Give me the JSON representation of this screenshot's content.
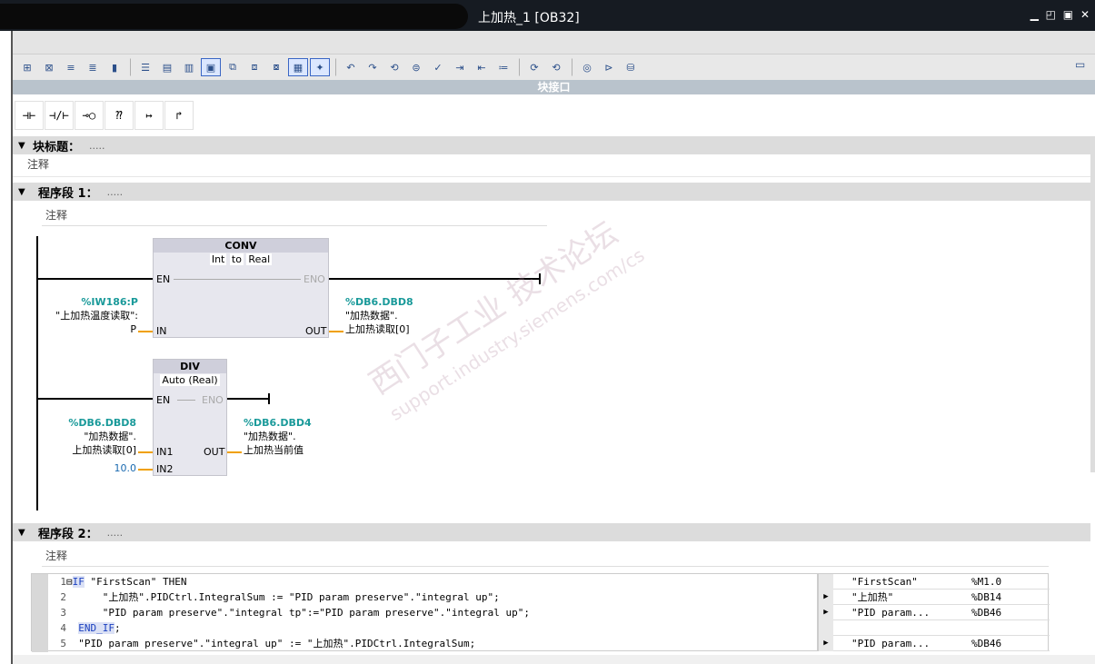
{
  "window": {
    "title": "上加热_1 [OB32]",
    "controls": "▁ ◰ ▣ ✕"
  },
  "interface_bar": {
    "label": "块接口"
  },
  "ladder_toolbar": {
    "items": [
      "⊣⊢",
      "⊣/⊢",
      "⊸○",
      "⁇",
      "↦",
      "↱"
    ]
  },
  "block_title": {
    "label": "块标题：",
    "dots": ".....",
    "comment": "注释"
  },
  "network1": {
    "label": "程序段 1：",
    "dots": ".....",
    "comment": "注释",
    "conv": {
      "name": "CONV",
      "types": [
        "Int",
        "to",
        "Real"
      ],
      "en": "EN",
      "eno": "ENO",
      "in": "IN",
      "out": "OUT",
      "in_address": "%IW186:P",
      "in_symbol": "\"上加热温度读取\":",
      "in_suffix": "P",
      "out_address": "%DB6.DBD8",
      "out_symbol1": "\"加热数据\".",
      "out_symbol2": "上加热读取[0]"
    },
    "div": {
      "name": "DIV",
      "type": "Auto (Real)",
      "en": "EN",
      "eno": "ENO",
      "in1": "IN1",
      "in2": "IN2",
      "out": "OUT",
      "in1_address": "%DB6.DBD8",
      "in1_symbol1": "\"加热数据\".",
      "in1_symbol2": "上加热读取[0]",
      "in2_value": "10.0",
      "out_address": "%DB6.DBD4",
      "out_symbol1": "\"加热数据\".",
      "out_symbol2": "上加热当前值"
    }
  },
  "network2": {
    "label": "程序段 2：",
    "dots": ".....",
    "comment": "注释",
    "lines": [
      {
        "n": "1",
        "fold": "⊟",
        "pre": "",
        "kw": "IF",
        "rest": " \"FirstScan\" THEN"
      },
      {
        "n": "2",
        "fold": "",
        "pre": "    ",
        "kw": "",
        "rest": "\"上加热\".PIDCtrl.IntegralSum := \"PID param preserve\".\"integral up\";"
      },
      {
        "n": "3",
        "fold": "",
        "pre": "    ",
        "kw": "",
        "rest": "\"PID param preserve\".\"integral tp\":=\"PID param preserve\".\"integral up\";"
      },
      {
        "n": "4",
        "fold": "",
        "pre": "",
        "kw": "END_IF",
        "rest": ";"
      },
      {
        "n": "5",
        "fold": "",
        "pre": "",
        "kw": "",
        "rest": "\"PID param preserve\".\"integral up\" := \"上加热\".PIDCtrl.IntegralSum;"
      }
    ],
    "xref": [
      {
        "arrow": "",
        "name": "\"FirstScan\"",
        "addr": "%M1.0"
      },
      {
        "arrow": "▶",
        "name": "\"上加热\"",
        "addr": "%DB14"
      },
      {
        "arrow": "▶",
        "name": "\"PID param...",
        "addr": "%DB46"
      },
      {
        "arrow": "",
        "name": "",
        "addr": ""
      },
      {
        "arrow": "▶",
        "name": "\"PID param...",
        "addr": "%DB46"
      }
    ]
  },
  "watermark": {
    "line1": "西门子工业  技术论坛",
    "line2": "support.industry.siemens.com/cs"
  }
}
